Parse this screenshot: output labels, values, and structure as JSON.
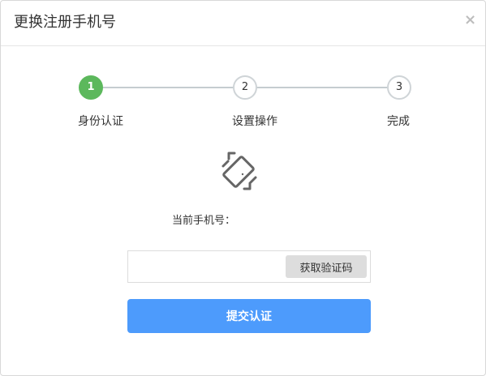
{
  "dialog": {
    "title": "更换注册手机号",
    "close_symbol": "×"
  },
  "steps": [
    {
      "number": "1",
      "label": "身份认证",
      "state": "active"
    },
    {
      "number": "2",
      "label": "设置操作",
      "state": "pending"
    },
    {
      "number": "3",
      "label": "完成",
      "state": "pending"
    }
  ],
  "icons": {
    "phone": "phone-rotate-icon",
    "close": "close-icon"
  },
  "form": {
    "current_phone_label": "当前手机号：",
    "current_phone_value": "",
    "code_input_value": "",
    "get_code_label": "获取验证码",
    "submit_label": "提交认证"
  },
  "colors": {
    "active_step": "#5cb85c",
    "submit_button": "#4d9bfc",
    "code_button": "#dddddd",
    "step_line": "#c5ccd0"
  }
}
